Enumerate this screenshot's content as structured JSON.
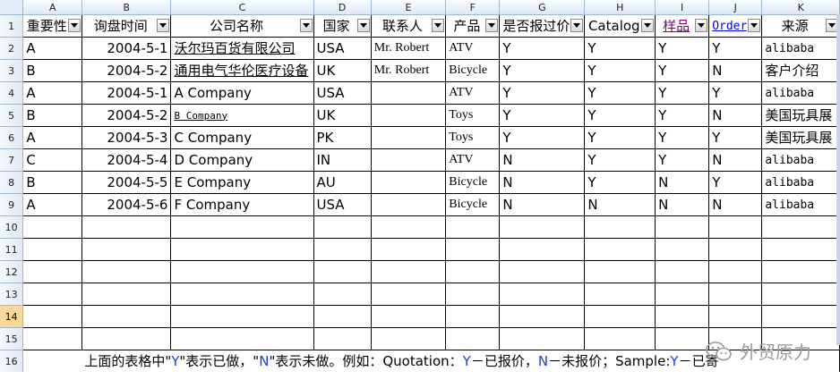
{
  "columns": [
    "A",
    "B",
    "C",
    "D",
    "E",
    "F",
    "G",
    "H",
    "I",
    "J",
    "K"
  ],
  "headers": [
    "重要性",
    "询盘时间",
    "公司名称",
    "国家",
    "联系人",
    "产品",
    "是否报过价",
    "Catalog",
    "样品",
    "Order",
    "来源"
  ],
  "rows": [
    [
      "A",
      "2004-5-1",
      "沃尔玛百货有限公司",
      "USA",
      "Mr. Robert",
      "ATV",
      "Y",
      "Y",
      "Y",
      "Y",
      "alibaba"
    ],
    [
      "B",
      "2004-5-2",
      "通用电气华伦医疗设备",
      "UK",
      "Mr. Robert",
      "Bicycle",
      "Y",
      "Y",
      "Y",
      "N",
      "客户介绍"
    ],
    [
      "A",
      "2004-5-1",
      "A Company",
      "USA",
      "",
      "ATV",
      "Y",
      "Y",
      "Y",
      "Y",
      "alibaba"
    ],
    [
      "B",
      "2004-5-2",
      "B Company",
      "UK",
      "",
      "Toys",
      "Y",
      "Y",
      "Y",
      "N",
      "美国玩具展"
    ],
    [
      "A",
      "2004-5-3",
      "C Company",
      "PK",
      "",
      "Toys",
      "Y",
      "Y",
      "Y",
      "Y",
      "美国玩具展"
    ],
    [
      "C",
      "2004-5-4",
      "D Company",
      "IN",
      "",
      "ATV",
      "N",
      "Y",
      "Y",
      "N",
      "alibaba"
    ],
    [
      "B",
      "2004-5-5",
      "E Company",
      "AU",
      "",
      "Bicycle",
      "N",
      "Y",
      "N",
      "Y",
      "alibaba"
    ],
    [
      "A",
      "2004-5-6",
      "F Company",
      "USA",
      "",
      "Bicycle",
      "N",
      "N",
      "N",
      "N",
      "alibaba"
    ]
  ],
  "row_numbers": [
    "1",
    "2",
    "3",
    "4",
    "5",
    "6",
    "7",
    "8",
    "9",
    "10",
    "11",
    "12",
    "13",
    "14",
    "15",
    "16"
  ],
  "note": {
    "p1": "上面的表格中\"",
    "y": "Y",
    "p2": "\"表示已做，\"",
    "n": "N",
    "p3": "\"表示未做。例如：Quotation：",
    "y2": "Y",
    "p4": "－已报价，",
    "n2": "N",
    "p5": "－未报价；Sample:",
    "y3": "Y",
    "p6": "－已寄"
  },
  "watermark": {
    "text": "外贸原力",
    "icon": "wechat-icon"
  },
  "colors": {
    "link": "#0000ee",
    "header_bg": "#dde8f5",
    "active_row": "#f9d99a"
  }
}
